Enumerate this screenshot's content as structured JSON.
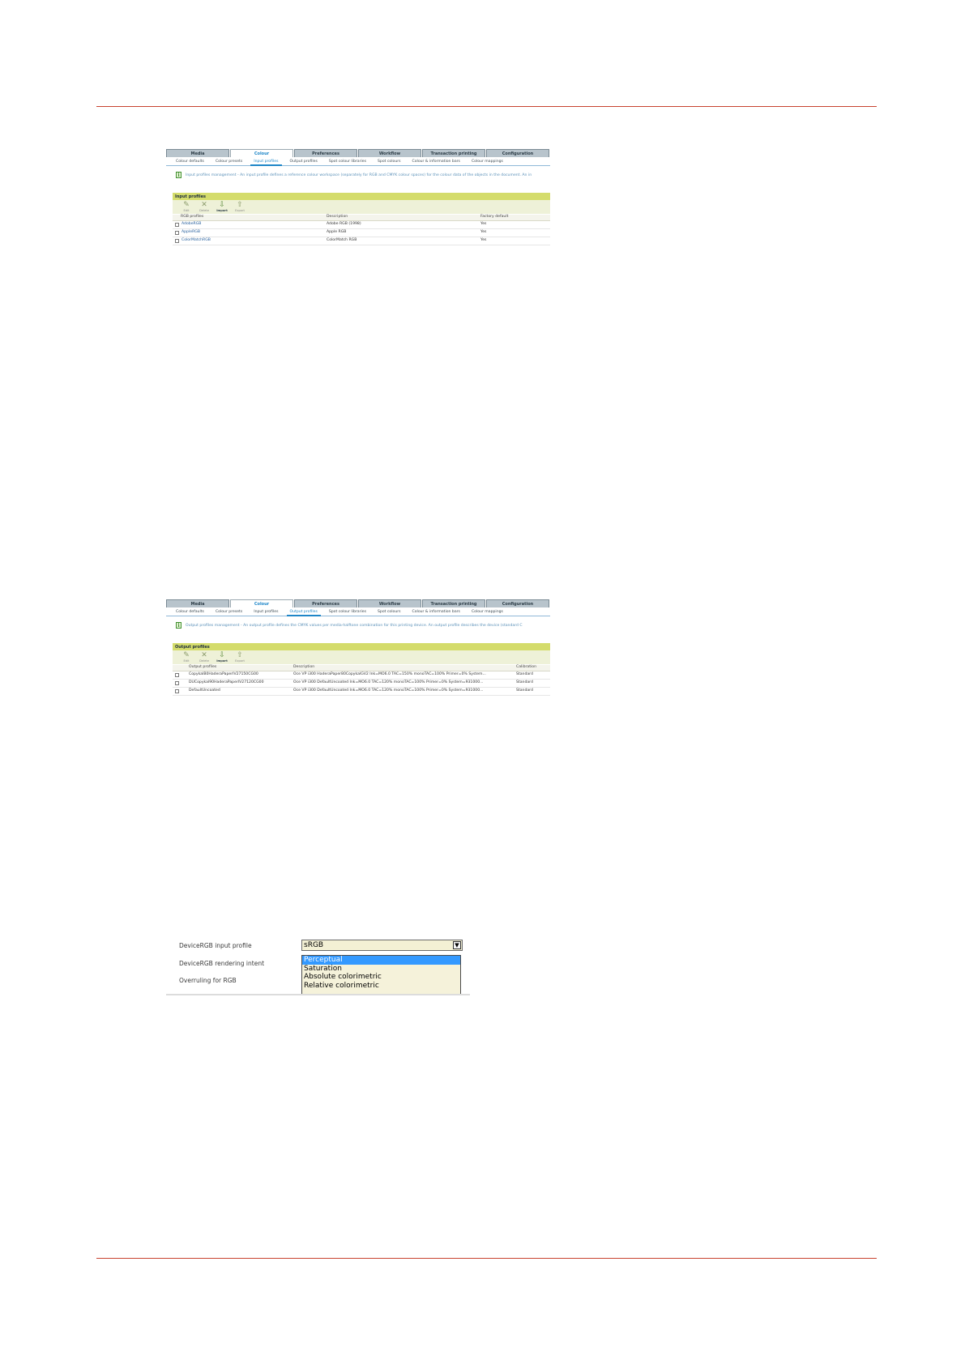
{
  "screen1": {
    "tabs": [
      "Media",
      "Colour",
      "Preferences",
      "Workflow",
      "Transaction printing",
      "Configuration"
    ],
    "active_tab": "Colour",
    "subtabs": [
      "Colour defaults",
      "Colour presets",
      "Input profiles",
      "Output profiles",
      "Spot colour libraries",
      "Spot colours",
      "Colour & information bars",
      "Colour mappings"
    ],
    "active_subtab": "Input profiles",
    "info_text": "Input profiles management - An input profile defines a reference colour workspace (separately for RGB and CMYK colour spaces) for the colour data of the objects in the document. An in",
    "section_title": "Input profiles",
    "toolbar": {
      "edit": "Edit",
      "delete": "Delete",
      "import": "Import",
      "export": "Export"
    },
    "columns": [
      "RGB profiles",
      "Description",
      "Factory default"
    ],
    "rows": [
      {
        "name": "AdobeRGB",
        "description": "Adobe RGB (1998)",
        "factory_default": "Yes"
      },
      {
        "name": "AppleRGB",
        "description": "Apple RGB",
        "factory_default": "Yes"
      },
      {
        "name": "ColorMatchRGB",
        "description": "ColorMatch RGB",
        "factory_default": "Yes"
      }
    ]
  },
  "screen2": {
    "tabs": [
      "Media",
      "Colour",
      "Preferences",
      "Workflow",
      "Transaction printing",
      "Configuration"
    ],
    "active_tab": "Colour",
    "subtabs": [
      "Colour defaults",
      "Colour presets",
      "Input profiles",
      "Output profiles",
      "Spot colour libraries",
      "Spot colours",
      "Colour & information bars",
      "Colour mappings"
    ],
    "active_subtab": "Output profiles",
    "info_text": "Output profiles management - An output profile defines the CMYK values per media-halftone combination for this printing device. An output profile describes the device (standard C",
    "section_title": "Output profiles",
    "toolbar": {
      "edit": "Edit",
      "delete": "Delete",
      "import": "Import",
      "export": "Export"
    },
    "columns": [
      "Output profiles",
      "Description",
      "Calibration"
    ],
    "rows": [
      {
        "name": "CopykalB0HaderaPaperIV27150CG00",
        "description": "Oce VP i300 HaderaPaper80CopykalGV2 Ink=MO6.0 TAC=150% monoTAC=100% Primer=0% System...",
        "calibration": "Standard"
      },
      {
        "name": "DUCopykal90HaderaPaperIV27120CG00",
        "description": "Oce VP i300 DefaultUncoated Ink=MO6.0 TAC=120% monoTAC=100% Primer=0% System=931000...",
        "calibration": "Standard"
      },
      {
        "name": "DefaultUncoated",
        "description": "Oce VP i300 DefaultUncoated Ink=MO6.0 TAC=120% monoTAC=100% Primer=0% System=931000...",
        "calibration": "Standard"
      }
    ]
  },
  "screen3": {
    "labels": {
      "input_profile": "DeviceRGB input profile",
      "rendering_intent": "DeviceRGB rendering intent",
      "overruling": "Overruling for RGB"
    },
    "input_profile_value": "sRGB",
    "rendering_intent_options": [
      "Perceptual",
      "Saturation",
      "Absolute colorimetric",
      "Relative colorimetric"
    ],
    "selected_option": "Perceptual"
  },
  "colors": {
    "accent_rule": "#c8432f",
    "section_bar": "#d4dc6c",
    "active_tab_text": "#1e86c8",
    "selected_option": "#3399ff"
  }
}
